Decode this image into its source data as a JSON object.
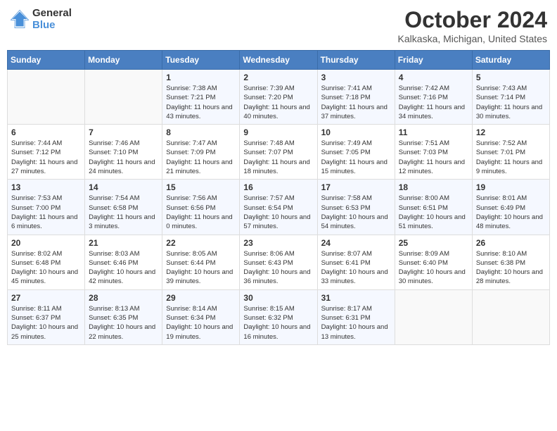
{
  "header": {
    "logo_line1": "General",
    "logo_line2": "Blue",
    "month": "October 2024",
    "location": "Kalkaska, Michigan, United States"
  },
  "weekdays": [
    "Sunday",
    "Monday",
    "Tuesday",
    "Wednesday",
    "Thursday",
    "Friday",
    "Saturday"
  ],
  "weeks": [
    [
      {
        "day": "",
        "sunrise": "",
        "sunset": "",
        "daylight": ""
      },
      {
        "day": "",
        "sunrise": "",
        "sunset": "",
        "daylight": ""
      },
      {
        "day": "1",
        "sunrise": "Sunrise: 7:38 AM",
        "sunset": "Sunset: 7:21 PM",
        "daylight": "Daylight: 11 hours and 43 minutes."
      },
      {
        "day": "2",
        "sunrise": "Sunrise: 7:39 AM",
        "sunset": "Sunset: 7:20 PM",
        "daylight": "Daylight: 11 hours and 40 minutes."
      },
      {
        "day": "3",
        "sunrise": "Sunrise: 7:41 AM",
        "sunset": "Sunset: 7:18 PM",
        "daylight": "Daylight: 11 hours and 37 minutes."
      },
      {
        "day": "4",
        "sunrise": "Sunrise: 7:42 AM",
        "sunset": "Sunset: 7:16 PM",
        "daylight": "Daylight: 11 hours and 34 minutes."
      },
      {
        "day": "5",
        "sunrise": "Sunrise: 7:43 AM",
        "sunset": "Sunset: 7:14 PM",
        "daylight": "Daylight: 11 hours and 30 minutes."
      }
    ],
    [
      {
        "day": "6",
        "sunrise": "Sunrise: 7:44 AM",
        "sunset": "Sunset: 7:12 PM",
        "daylight": "Daylight: 11 hours and 27 minutes."
      },
      {
        "day": "7",
        "sunrise": "Sunrise: 7:46 AM",
        "sunset": "Sunset: 7:10 PM",
        "daylight": "Daylight: 11 hours and 24 minutes."
      },
      {
        "day": "8",
        "sunrise": "Sunrise: 7:47 AM",
        "sunset": "Sunset: 7:09 PM",
        "daylight": "Daylight: 11 hours and 21 minutes."
      },
      {
        "day": "9",
        "sunrise": "Sunrise: 7:48 AM",
        "sunset": "Sunset: 7:07 PM",
        "daylight": "Daylight: 11 hours and 18 minutes."
      },
      {
        "day": "10",
        "sunrise": "Sunrise: 7:49 AM",
        "sunset": "Sunset: 7:05 PM",
        "daylight": "Daylight: 11 hours and 15 minutes."
      },
      {
        "day": "11",
        "sunrise": "Sunrise: 7:51 AM",
        "sunset": "Sunset: 7:03 PM",
        "daylight": "Daylight: 11 hours and 12 minutes."
      },
      {
        "day": "12",
        "sunrise": "Sunrise: 7:52 AM",
        "sunset": "Sunset: 7:01 PM",
        "daylight": "Daylight: 11 hours and 9 minutes."
      }
    ],
    [
      {
        "day": "13",
        "sunrise": "Sunrise: 7:53 AM",
        "sunset": "Sunset: 7:00 PM",
        "daylight": "Daylight: 11 hours and 6 minutes."
      },
      {
        "day": "14",
        "sunrise": "Sunrise: 7:54 AM",
        "sunset": "Sunset: 6:58 PM",
        "daylight": "Daylight: 11 hours and 3 minutes."
      },
      {
        "day": "15",
        "sunrise": "Sunrise: 7:56 AM",
        "sunset": "Sunset: 6:56 PM",
        "daylight": "Daylight: 11 hours and 0 minutes."
      },
      {
        "day": "16",
        "sunrise": "Sunrise: 7:57 AM",
        "sunset": "Sunset: 6:54 PM",
        "daylight": "Daylight: 10 hours and 57 minutes."
      },
      {
        "day": "17",
        "sunrise": "Sunrise: 7:58 AM",
        "sunset": "Sunset: 6:53 PM",
        "daylight": "Daylight: 10 hours and 54 minutes."
      },
      {
        "day": "18",
        "sunrise": "Sunrise: 8:00 AM",
        "sunset": "Sunset: 6:51 PM",
        "daylight": "Daylight: 10 hours and 51 minutes."
      },
      {
        "day": "19",
        "sunrise": "Sunrise: 8:01 AM",
        "sunset": "Sunset: 6:49 PM",
        "daylight": "Daylight: 10 hours and 48 minutes."
      }
    ],
    [
      {
        "day": "20",
        "sunrise": "Sunrise: 8:02 AM",
        "sunset": "Sunset: 6:48 PM",
        "daylight": "Daylight: 10 hours and 45 minutes."
      },
      {
        "day": "21",
        "sunrise": "Sunrise: 8:03 AM",
        "sunset": "Sunset: 6:46 PM",
        "daylight": "Daylight: 10 hours and 42 minutes."
      },
      {
        "day": "22",
        "sunrise": "Sunrise: 8:05 AM",
        "sunset": "Sunset: 6:44 PM",
        "daylight": "Daylight: 10 hours and 39 minutes."
      },
      {
        "day": "23",
        "sunrise": "Sunrise: 8:06 AM",
        "sunset": "Sunset: 6:43 PM",
        "daylight": "Daylight: 10 hours and 36 minutes."
      },
      {
        "day": "24",
        "sunrise": "Sunrise: 8:07 AM",
        "sunset": "Sunset: 6:41 PM",
        "daylight": "Daylight: 10 hours and 33 minutes."
      },
      {
        "day": "25",
        "sunrise": "Sunrise: 8:09 AM",
        "sunset": "Sunset: 6:40 PM",
        "daylight": "Daylight: 10 hours and 30 minutes."
      },
      {
        "day": "26",
        "sunrise": "Sunrise: 8:10 AM",
        "sunset": "Sunset: 6:38 PM",
        "daylight": "Daylight: 10 hours and 28 minutes."
      }
    ],
    [
      {
        "day": "27",
        "sunrise": "Sunrise: 8:11 AM",
        "sunset": "Sunset: 6:37 PM",
        "daylight": "Daylight: 10 hours and 25 minutes."
      },
      {
        "day": "28",
        "sunrise": "Sunrise: 8:13 AM",
        "sunset": "Sunset: 6:35 PM",
        "daylight": "Daylight: 10 hours and 22 minutes."
      },
      {
        "day": "29",
        "sunrise": "Sunrise: 8:14 AM",
        "sunset": "Sunset: 6:34 PM",
        "daylight": "Daylight: 10 hours and 19 minutes."
      },
      {
        "day": "30",
        "sunrise": "Sunrise: 8:15 AM",
        "sunset": "Sunset: 6:32 PM",
        "daylight": "Daylight: 10 hours and 16 minutes."
      },
      {
        "day": "31",
        "sunrise": "Sunrise: 8:17 AM",
        "sunset": "Sunset: 6:31 PM",
        "daylight": "Daylight: 10 hours and 13 minutes."
      },
      {
        "day": "",
        "sunrise": "",
        "sunset": "",
        "daylight": ""
      },
      {
        "day": "",
        "sunrise": "",
        "sunset": "",
        "daylight": ""
      }
    ]
  ]
}
